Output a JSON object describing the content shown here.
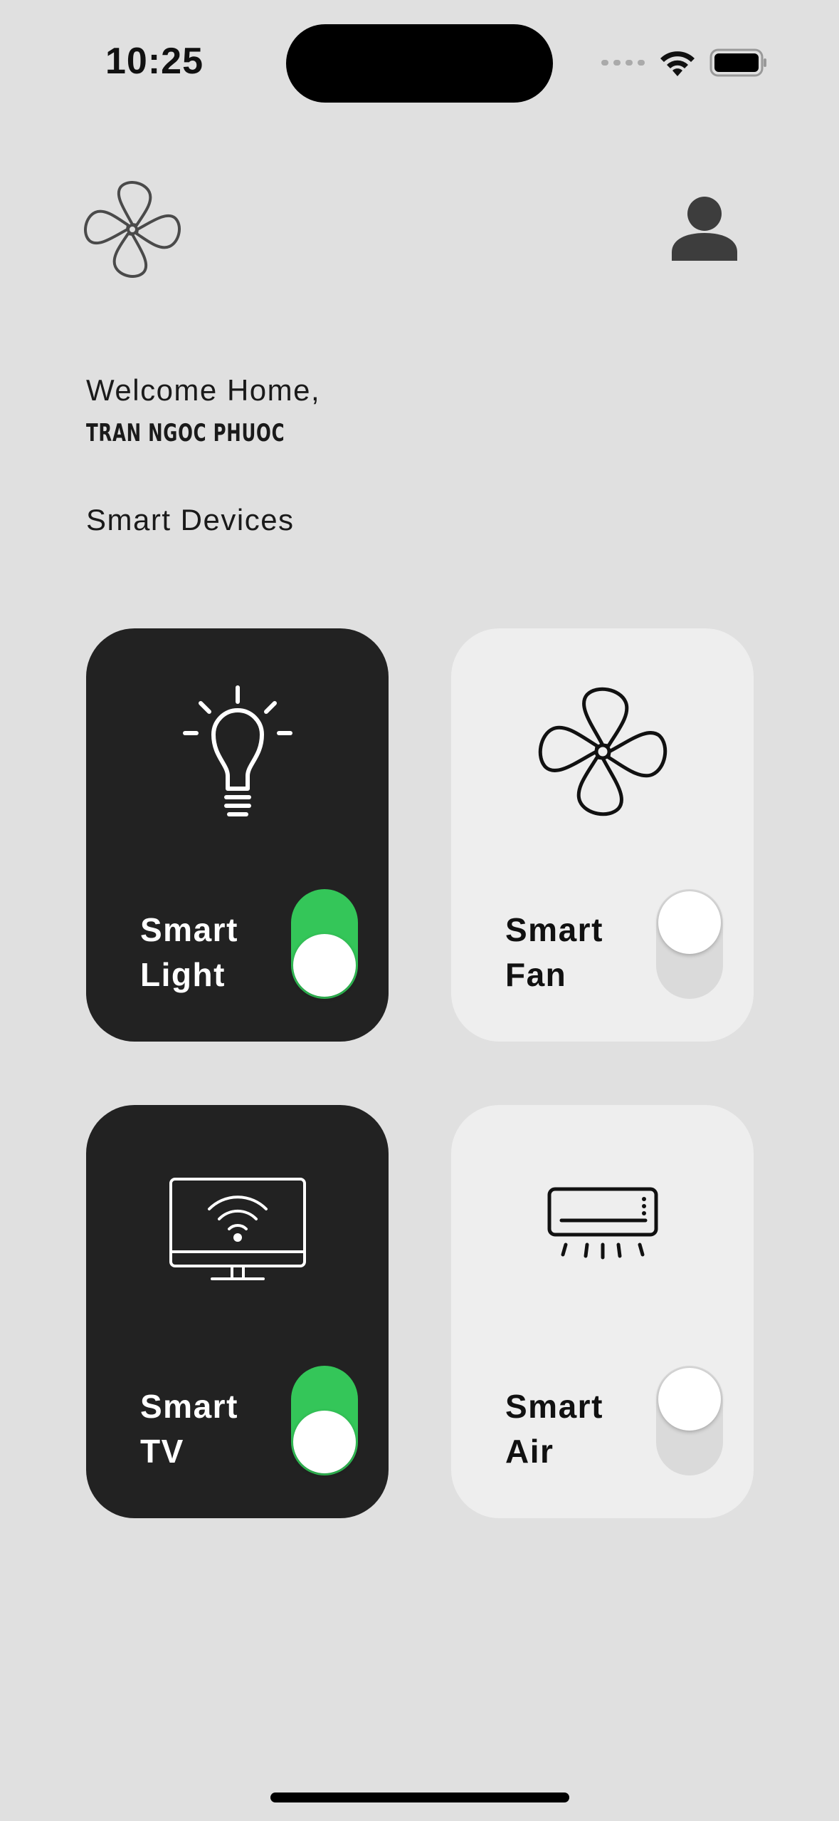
{
  "status_bar": {
    "time": "10:25"
  },
  "header": {
    "logo_icon": "fan-icon",
    "profile_icon": "person-icon"
  },
  "greeting": {
    "welcome": "Welcome Home,",
    "name": "TRAN NGOC PHUOC"
  },
  "section": {
    "title": "Smart Devices"
  },
  "devices": [
    {
      "line1": "Smart",
      "line2": "Light",
      "icon": "lightbulb-icon",
      "on": true,
      "theme": "dark"
    },
    {
      "line1": "Smart",
      "line2": "Fan",
      "icon": "fan-icon",
      "on": false,
      "theme": "light"
    },
    {
      "line1": "Smart",
      "line2": "TV",
      "icon": "tv-icon",
      "on": true,
      "theme": "dark"
    },
    {
      "line1": "Smart",
      "line2": "Air",
      "icon": "air-conditioner-icon",
      "on": false,
      "theme": "light"
    }
  ],
  "colors": {
    "background": "#e0e0e0",
    "card_dark": "#222222",
    "card_light": "#eeeeee",
    "toggle_on": "#34c659",
    "toggle_off": "#dadada"
  }
}
